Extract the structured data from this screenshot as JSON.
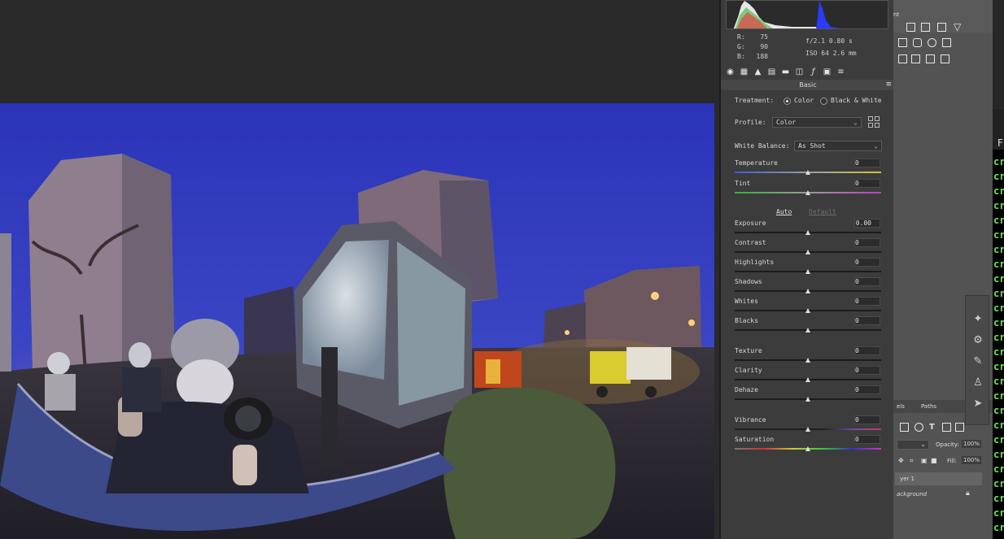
{
  "readout": {
    "r_label": "R:",
    "r_value": "75",
    "g_label": "G:",
    "g_value": "90",
    "b_label": "B:",
    "b_value": "188",
    "aperture_shutter": "f/2.1  0.80 s",
    "iso_focal": "ISO 64  2.6 mm"
  },
  "panel": {
    "section_title": "Basic",
    "treatment_label": "Treatment:",
    "treatment_color": "Color",
    "treatment_bw": "Black & White",
    "profile_label": "Profile:",
    "profile_value": "Color",
    "wb_label": "White Balance:",
    "wb_value": "As Shot",
    "auto_label": "Auto",
    "default_label": "Default",
    "sliders": {
      "temperature": {
        "label": "Temperature",
        "value": "0"
      },
      "tint": {
        "label": "Tint",
        "value": "0"
      },
      "exposure": {
        "label": "Exposure",
        "value": "0.00"
      },
      "contrast": {
        "label": "Contrast",
        "value": "0"
      },
      "highlights": {
        "label": "Highlights",
        "value": "0"
      },
      "shadows": {
        "label": "Shadows",
        "value": "0"
      },
      "whites": {
        "label": "Whites",
        "value": "0"
      },
      "blacks": {
        "label": "Blacks",
        "value": "0"
      },
      "texture": {
        "label": "Texture",
        "value": "0"
      },
      "clarity": {
        "label": "Clarity",
        "value": "0"
      },
      "dehaze": {
        "label": "Dehaze",
        "value": "0"
      },
      "vibrance": {
        "label": "Vibrance",
        "value": "0"
      },
      "saturation": {
        "label": "Saturation",
        "value": "0"
      }
    },
    "slider_position": 0.5
  },
  "photoshop": {
    "tab_fragment": "nt",
    "panel_tab_left": "els",
    "panel_tab_paths": "Paths",
    "opacity_label": "Opacity:",
    "opacity_value": "100%",
    "fill_label": "Fill:",
    "fill_value": "100%",
    "layer1": "yer 1",
    "background_layer": "ackground"
  },
  "terminal": {
    "header_fragment": "F",
    "line_fragment": "cr"
  },
  "colors": {
    "accent_terminal": "#6fe05a",
    "panel_bg": "#3c3c3c",
    "sky": "#2c3aa8"
  }
}
